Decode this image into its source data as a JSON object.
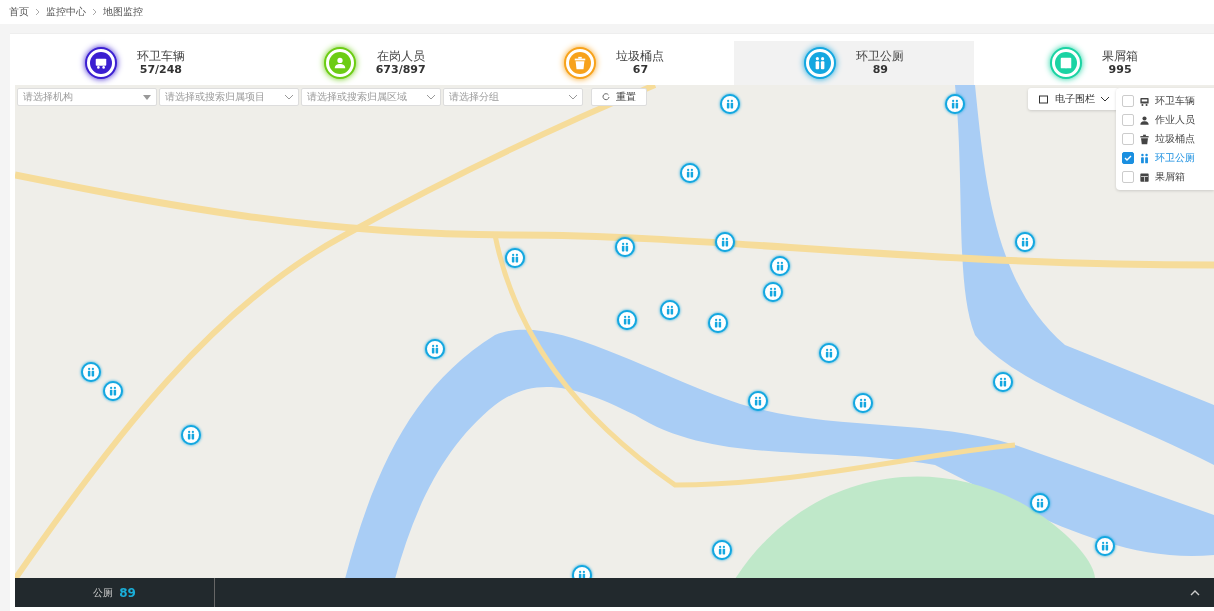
{
  "breadcrumb": [
    "首页",
    "监控中心",
    "地图监控"
  ],
  "stats": [
    {
      "kind": "vehicle",
      "label": "环卫车辆",
      "count": "57/248",
      "color": "#3b1fd1",
      "selected": false
    },
    {
      "kind": "person",
      "label": "在岗人员",
      "count": "673/897",
      "color": "#6ccc14",
      "selected": false
    },
    {
      "kind": "bin",
      "label": "垃圾桶点",
      "count": "67",
      "color": "#f7a21b",
      "selected": false
    },
    {
      "kind": "toilet",
      "label": "环卫公厕",
      "count": "89",
      "color": "#14a7e0",
      "selected": true
    },
    {
      "kind": "box",
      "label": "果屑箱",
      "count": "995",
      "color": "#1bd3a3",
      "selected": false
    }
  ],
  "filters": [
    {
      "kind": "solid",
      "placeholder": "请选择机构"
    },
    {
      "kind": "chevron",
      "placeholder": "请选择或搜索归属项目"
    },
    {
      "kind": "chevron",
      "placeholder": "请选择或搜索归属区域"
    },
    {
      "kind": "chevron",
      "placeholder": "请选择分组"
    }
  ],
  "reset_button": "重置",
  "fence_dropdown": "电子围栏",
  "layers": [
    {
      "kind": "vehicle",
      "label": "环卫车辆",
      "checked": false
    },
    {
      "kind": "person",
      "label": "作业人员",
      "checked": false
    },
    {
      "kind": "bin",
      "label": "垃圾桶点",
      "checked": false
    },
    {
      "kind": "toilet",
      "label": "环卫公厕",
      "checked": true
    },
    {
      "kind": "box",
      "label": "果屑箱",
      "checked": false
    }
  ],
  "status_bar": {
    "label": "公厕",
    "count": "89"
  }
}
